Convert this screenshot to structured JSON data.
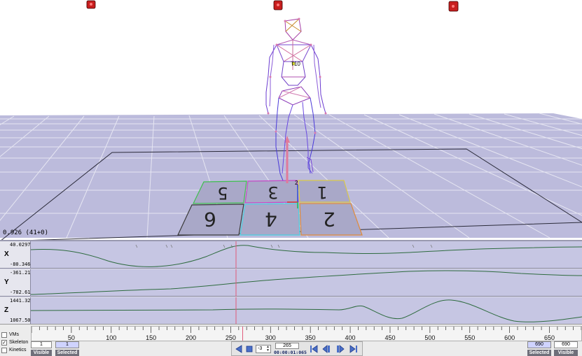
{
  "viewport": {
    "frame_readout": "0.926 (41+0)",
    "marker_label": "T10",
    "origin_label": "2",
    "tiles": [
      "5",
      "3",
      "1",
      "6",
      "4",
      "2"
    ]
  },
  "graphs": [
    {
      "axis": "X",
      "max": "40.0297",
      "min": "-80.3460"
    },
    {
      "axis": "Y",
      "max": "-361.217",
      "min": "-782.613"
    },
    {
      "axis": "Z",
      "max": "1441.32",
      "min": "1067.50"
    }
  ],
  "timeline": {
    "ticks": [
      "50",
      "100",
      "150",
      "200",
      "250",
      "300",
      "350",
      "400",
      "450",
      "500",
      "550",
      "600",
      "650"
    ],
    "tick_start": 50,
    "tick_step": 50,
    "tick_max": 690,
    "playhead_frame": 265,
    "checkboxes": [
      {
        "label": "VMs",
        "checked": false,
        "mark": ""
      },
      {
        "label": "Skeleton",
        "checked": true,
        "mark": "✓"
      },
      {
        "label": "Kinetics",
        "checked": false,
        "mark": ""
      }
    ],
    "left_visible_value": "1",
    "left_selected_value": "1",
    "left_visible_label": "Visible",
    "left_selected_label": "Selected",
    "right_selected_value": "690",
    "right_visible_value": "690",
    "right_selected_label": "Selected",
    "right_visible_label": "Visible",
    "step_value": "-3",
    "current_frame": "265",
    "time_readout": "00:00:01:065"
  },
  "colors": {
    "graph_bg": "#c6c6e3",
    "curve": "#2e6b3f",
    "playhead": "#e05a7a",
    "transport": "#4a6fc8",
    "floor": "#bcbbdc"
  },
  "icons": {
    "camera": "camera-icon",
    "play_reverse": "play-reverse-icon",
    "stop": "stop-icon",
    "go_first": "go-first-icon",
    "step_back": "step-back-icon",
    "step_forward": "step-forward-icon",
    "go_last": "go-last-icon"
  }
}
